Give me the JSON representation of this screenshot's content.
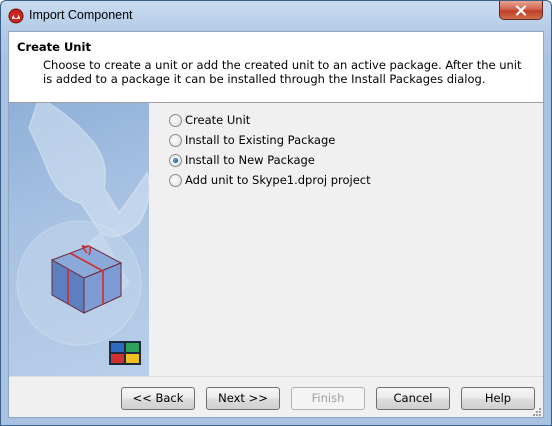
{
  "window": {
    "title": "Import Component",
    "accent": "#a9c2e2"
  },
  "header": {
    "title": "Create Unit",
    "description": "Choose to create a unit or add the created unit to an active package. After the unit is added to a package it can be installed through the Install Packages dialog."
  },
  "options": [
    {
      "label": "Create Unit",
      "checked": false
    },
    {
      "label": "Install to Existing Package",
      "checked": false
    },
    {
      "label": "Install to New Package",
      "checked": true
    },
    {
      "label": "Add unit to Skype1.dproj project",
      "checked": false
    }
  ],
  "buttons": {
    "back": "<< Back",
    "next": "Next >>",
    "finish": "Finish",
    "cancel": "Cancel",
    "help": "Help"
  },
  "icons": {
    "app": "delphi-helmet-icon",
    "close": "close-icon",
    "illustration": "wrench-package-illustration",
    "logo": "color-squares-logo"
  }
}
